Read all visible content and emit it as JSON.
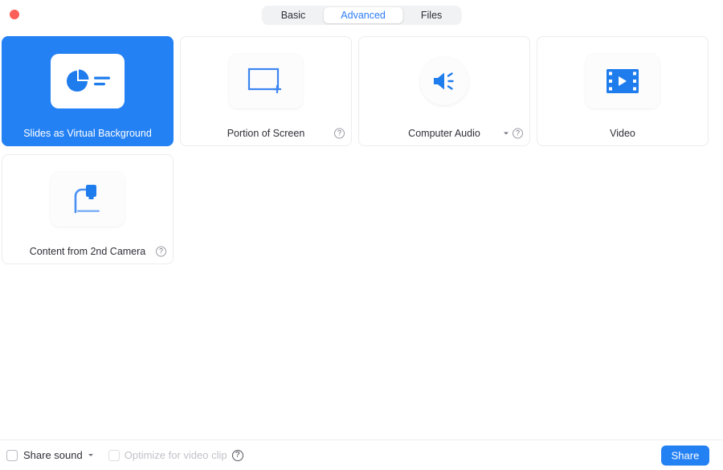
{
  "window": {
    "close_button": "close"
  },
  "tabs": [
    {
      "label": "Basic",
      "active": false
    },
    {
      "label": "Advanced",
      "active": true
    },
    {
      "label": "Files",
      "active": false
    }
  ],
  "cards": [
    {
      "label": "Slides as Virtual Background",
      "icon": "slides-virtual-background-icon",
      "selected": true,
      "has_help": false,
      "has_chevron": false,
      "icon_shape": "tile"
    },
    {
      "label": "Portion of Screen",
      "icon": "portion-of-screen-icon",
      "selected": false,
      "has_help": true,
      "has_chevron": false,
      "icon_shape": "tile"
    },
    {
      "label": "Computer Audio",
      "icon": "computer-audio-icon",
      "selected": false,
      "has_help": true,
      "has_chevron": true,
      "icon_shape": "circle"
    },
    {
      "label": "Video",
      "icon": "video-icon",
      "selected": false,
      "has_help": false,
      "has_chevron": false,
      "icon_shape": "tile"
    },
    {
      "label": "Content from 2nd Camera",
      "icon": "second-camera-icon",
      "selected": false,
      "has_help": true,
      "has_chevron": false,
      "icon_shape": "tile"
    }
  ],
  "bottom": {
    "share_sound_label": "Share sound",
    "share_sound_checked": false,
    "optimize_label": "Optimize for video clip",
    "optimize_checked": false,
    "optimize_disabled": true,
    "help_glyph": "?",
    "share_button_label": "Share"
  },
  "colors": {
    "accent": "#2481f3",
    "tab_active_text": "#2b7cf6",
    "close_dot": "#fc5f57",
    "card_border": "#ececef",
    "text": "#2e2e38",
    "disabled_text": "#c2c2c9"
  }
}
